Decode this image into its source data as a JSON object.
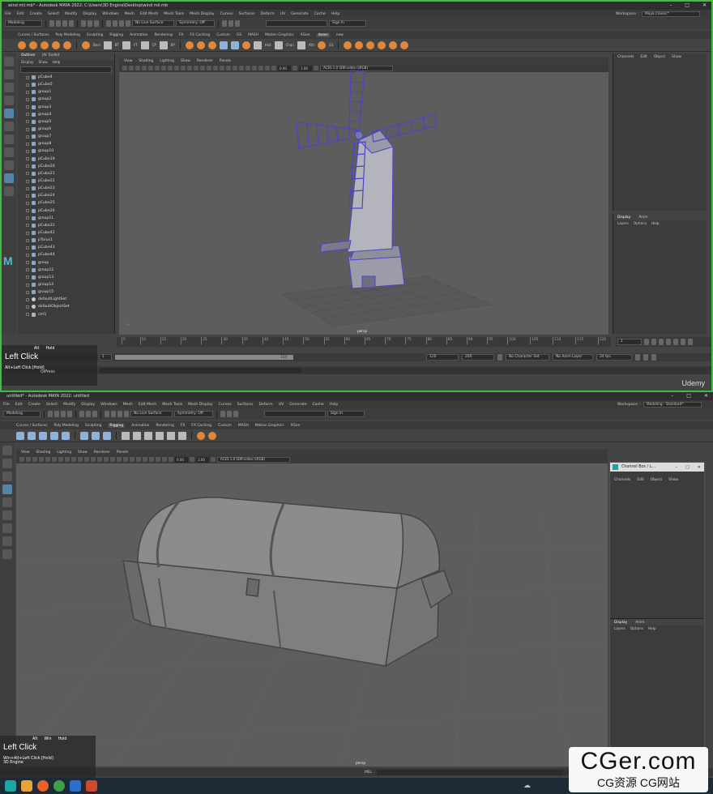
{
  "top": {
    "title": "wind mil.mb* - Autodesk MAYA 2022: C:\\Users\\3D Engine\\Desktop\\wind mil.mb",
    "window_controls": [
      "–",
      "□",
      "✕"
    ],
    "menus": [
      "File",
      "Edit",
      "Create",
      "Select",
      "Modify",
      "Display",
      "Windows",
      "Mesh",
      "Edit Mesh",
      "Mesh Tools",
      "Mesh Display",
      "Curves",
      "Surfaces",
      "Deform",
      "UV",
      "Generate",
      "Cache",
      "Help"
    ],
    "workspace_label": "Workspace :",
    "workspace_value": "Maya Classic*",
    "mode": "Modeling",
    "live_surface": "No Live Surface",
    "symmetry": "Symmetry: Off",
    "sign_in": "Sign In",
    "shelf_tabs": [
      "Curves / Surfaces",
      "Poly Modeling",
      "Sculpting",
      "Rigging",
      "Animation",
      "Rendering",
      "FX",
      "FX Caching",
      "Custom",
      "GS",
      "MASH",
      "Motion Graphics",
      "XGen",
      "deani",
      "new"
    ],
    "shelf_active": "deani",
    "shelf_labels": [
      "Bevl",
      "BT",
      "FT",
      "CP",
      "EP",
      "Hist",
      "Chan",
      "Attr",
      "ES"
    ],
    "outliner_tabs": [
      "Outliner",
      "UV Toolkit"
    ],
    "outliner_menu": [
      "Display",
      "Show",
      "Help"
    ],
    "outliner_items": [
      {
        "name": "pCube4",
        "kind": "mesh"
      },
      {
        "name": "pCube5",
        "kind": "mesh"
      },
      {
        "name": "group1",
        "kind": "group"
      },
      {
        "name": "group2",
        "kind": "group"
      },
      {
        "name": "group3",
        "kind": "group"
      },
      {
        "name": "group4",
        "kind": "group"
      },
      {
        "name": "group5",
        "kind": "group"
      },
      {
        "name": "group6",
        "kind": "group"
      },
      {
        "name": "group7",
        "kind": "group"
      },
      {
        "name": "group8",
        "kind": "group"
      },
      {
        "name": "group10",
        "kind": "group"
      },
      {
        "name": "pCube19",
        "kind": "mesh"
      },
      {
        "name": "pCube20",
        "kind": "mesh"
      },
      {
        "name": "pCube21",
        "kind": "mesh"
      },
      {
        "name": "pCube22",
        "kind": "mesh"
      },
      {
        "name": "pCube23",
        "kind": "mesh"
      },
      {
        "name": "pCube24",
        "kind": "mesh"
      },
      {
        "name": "pCube25",
        "kind": "mesh"
      },
      {
        "name": "pCube26",
        "kind": "mesh"
      },
      {
        "name": "group11",
        "kind": "group"
      },
      {
        "name": "pCube31",
        "kind": "mesh"
      },
      {
        "name": "pCube42",
        "kind": "mesh"
      },
      {
        "name": "pTorus1",
        "kind": "mesh"
      },
      {
        "name": "pCube43",
        "kind": "mesh"
      },
      {
        "name": "pCube44",
        "kind": "mesh"
      },
      {
        "name": "group",
        "kind": "group"
      },
      {
        "name": "group12",
        "kind": "group"
      },
      {
        "name": "group13",
        "kind": "group"
      },
      {
        "name": "group14",
        "kind": "group"
      },
      {
        "name": "group15",
        "kind": "group"
      },
      {
        "name": "defaultLightSet",
        "kind": "set"
      },
      {
        "name": "defaultObjectSet",
        "kind": "set"
      },
      {
        "name": "ctrl1",
        "kind": "cam"
      }
    ],
    "vp_menu": [
      "View",
      "Shading",
      "Lighting",
      "Show",
      "Renderer",
      "Panels"
    ],
    "vp_num1": "0.00",
    "vp_num2": "1.00",
    "color_space": "ACES 1.0 SDR-video (sRGB)",
    "camera": "persp",
    "channel_menu": [
      "Channels",
      "Edit",
      "Object",
      "Show"
    ],
    "layer_tabs": [
      "Display",
      "Anim"
    ],
    "layer_menu": [
      "Layers",
      "Options",
      "Help"
    ],
    "timeline_ticks": [
      "5",
      "10",
      "15",
      "20",
      "25",
      "30",
      "35",
      "40",
      "45",
      "50",
      "55",
      "60",
      "65",
      "70",
      "75",
      "80",
      "85",
      "90",
      "95",
      "100",
      "105",
      "110",
      "115",
      "120"
    ],
    "current_frame": "1",
    "range_start": "1",
    "range_end": "120",
    "playback_end": "120",
    "anim_end": "200",
    "character_set": "No Character Set",
    "anim_layer": "No Anim Layer",
    "fps": "24 fps",
    "overlay_keys": [
      "Alt",
      "Hold"
    ],
    "overlay_big": "Left Click",
    "overlay_hint": "Alt+Left Click [Hold]",
    "overlay_sub": "QiPress",
    "brand": "Udemy"
  },
  "bottom": {
    "title": "untitled* - Autodesk MAYA 2022: untitled",
    "window_controls": [
      "–",
      "□",
      "✕"
    ],
    "menus": [
      "File",
      "Edit",
      "Create",
      "Select",
      "Modify",
      "Display",
      "Windows",
      "Mesh",
      "Edit Mesh",
      "Mesh Tools",
      "Mesh Display",
      "Curves",
      "Surfaces",
      "Deform",
      "UV",
      "Generate",
      "Cache",
      "Help"
    ],
    "workspace_label": "Workspace :",
    "workspace_value": "Modeling - Standard*",
    "mode": "Modeling",
    "live_surface": "No Live Surface",
    "symmetry": "Symmetry: Off",
    "sign_in": "Sign In",
    "shelf_tabs": [
      "Curves / Surfaces",
      "Poly Modeling",
      "Sculpting",
      "Rigging",
      "Animation",
      "Rendering",
      "FX",
      "FX Caching",
      "Custom",
      "MASH",
      "Motion Graphics",
      "XGen"
    ],
    "shelf_active": "Rigging",
    "vp_menu": [
      "View",
      "Shading",
      "Lighting",
      "Show",
      "Renderer",
      "Panels"
    ],
    "vp_num1": "0.00",
    "vp_num2": "1.00",
    "color_space": "ACES 1.0 SDR-video (sRGB)",
    "camera": "persp",
    "float_title": "Channel Box / L...",
    "channel_menu": [
      "Channels",
      "Edit",
      "Object",
      "Show"
    ],
    "layer_tabs": [
      "Display",
      "Anim"
    ],
    "layer_menu": [
      "Layers",
      "Options",
      "Help"
    ],
    "cmd_label": "MEL",
    "overlay_keys": [
      "Alt",
      "Win",
      "Hold"
    ],
    "overlay_big": "Left Click",
    "overlay_hint": "Win+Alt+Left Click [Hold]",
    "overlay_sub": "3D Engine",
    "watermark_main": "CGer.com",
    "watermark_sub": "CG资源 CG网站"
  },
  "colors": {
    "selection_wire": "#4b44c8",
    "frame_green": "#3fbf3f",
    "shelf_icon": "#e0873a"
  }
}
